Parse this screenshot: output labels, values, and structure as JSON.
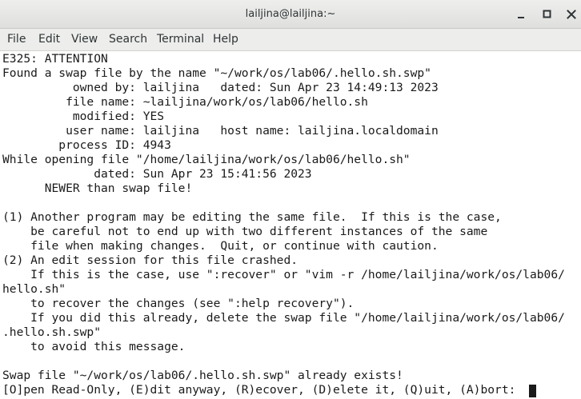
{
  "window": {
    "title": "lailjina@lailjina:~"
  },
  "menubar": {
    "items": [
      "File",
      "Edit",
      "View",
      "Search",
      "Terminal",
      "Help"
    ]
  },
  "terminal": {
    "lines": [
      "E325: ATTENTION",
      "Found a swap file by the name \"~/work/os/lab06/.hello.sh.swp\"",
      "          owned by: lailjina   dated: Sun Apr 23 14:49:13 2023",
      "         file name: ~lailjina/work/os/lab06/hello.sh",
      "          modified: YES",
      "         user name: lailjina   host name: lailjina.localdomain",
      "        process ID: 4943",
      "While opening file \"/home/lailjina/work/os/lab06/hello.sh\"",
      "             dated: Sun Apr 23 15:41:56 2023",
      "      NEWER than swap file!",
      "",
      "(1) Another program may be editing the same file.  If this is the case,",
      "    be careful not to end up with two different instances of the same",
      "    file when making changes.  Quit, or continue with caution.",
      "(2) An edit session for this file crashed.",
      "    If this is the case, use \":recover\" or \"vim -r /home/lailjina/work/os/lab06/",
      "hello.sh\"",
      "    to recover the changes (see \":help recovery\").",
      "    If you did this already, delete the swap file \"/home/lailjina/work/os/lab06/",
      ".hello.sh.swp\"",
      "    to avoid this message.",
      "",
      "Swap file \"~/work/os/lab06/.hello.sh.swp\" already exists!",
      "[O]pen Read-Only, (E)dit anyway, (R)ecover, (D)elete it, (Q)uit, (A)bort:"
    ]
  }
}
